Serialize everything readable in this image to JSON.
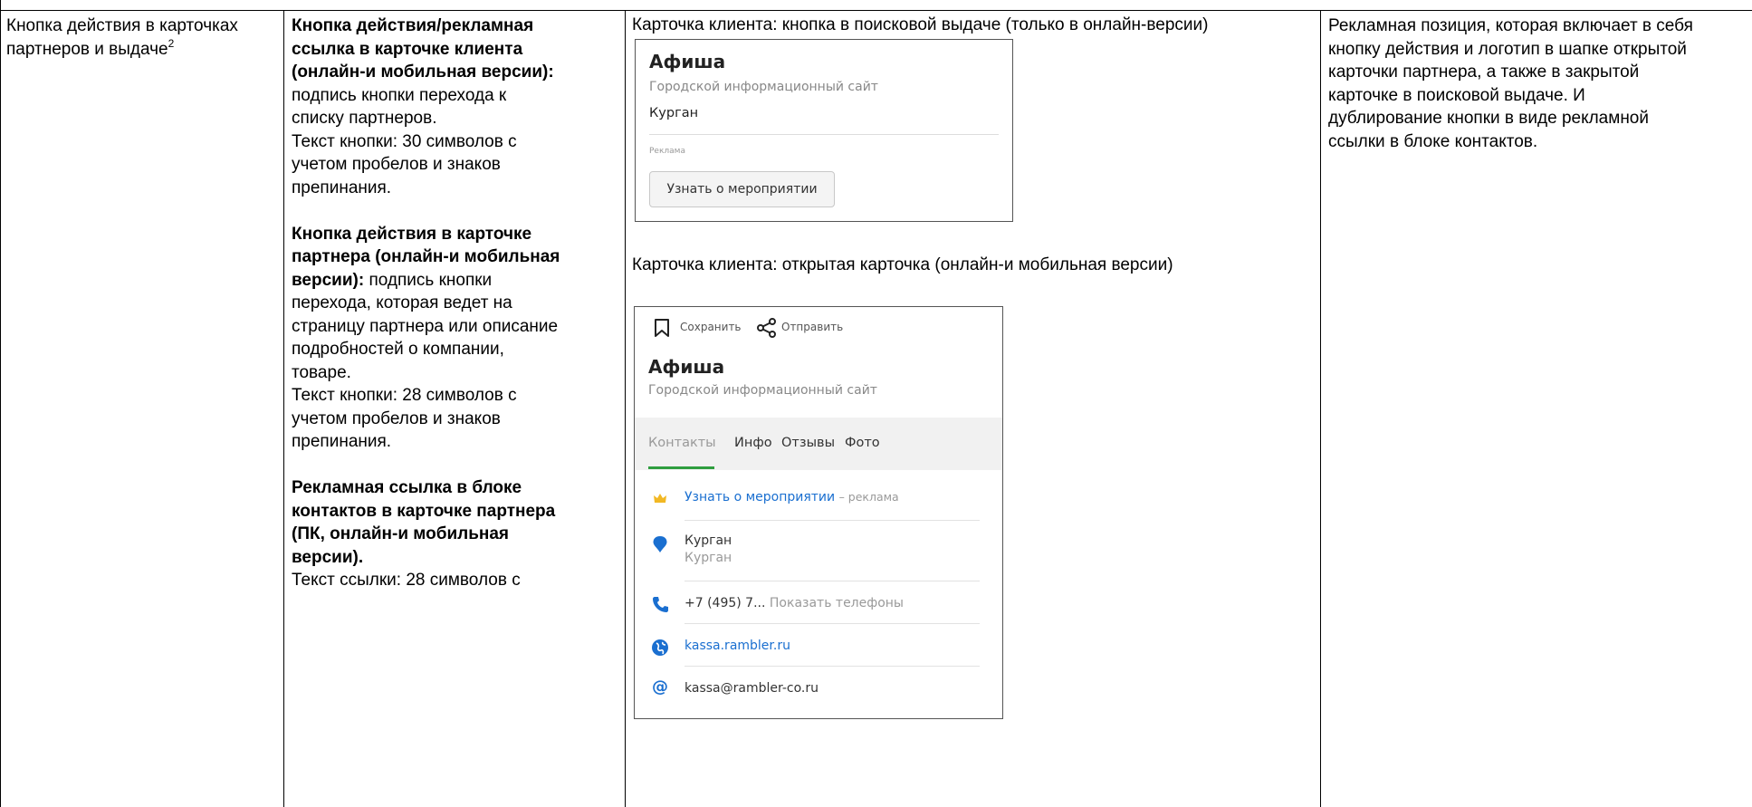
{
  "col1": {
    "text": "Кнопка действия в карточках партнеров и выдаче",
    "footnote": "2"
  },
  "col2": {
    "block1_bold": "Кнопка действия/рекламная ссылка в карточке клиента (онлайн-и мобильная версии):",
    "block1_text": "подпись кнопки перехода к списку партнеров.",
    "block1_limit": "Текст кнопки: 30 символов с учетом пробелов и знаков препинания.",
    "block2_bold": "Кнопка действия в карточке партнера (онлайн-и мобильная версии):",
    "block2_text": "подпись кнопки перехода, которая ведет на страницу партнера или описание подробностей о компании, товаре.",
    "block2_limit": "Текст кнопки: 28 символов с учетом пробелов и знаков препинания.",
    "block3_bold": "Рекламная ссылка в блоке контактов в карточке партнера (ПК, онлайн-и мобильная версии).",
    "block3_limit": "Текст ссылки: 28 символов с"
  },
  "col3": {
    "caption1": "Карточка клиента: кнопка в поисковой выдаче (только в онлайн-версии)",
    "caption2": "Карточка клиента: открытая карточка (онлайн-и мобильная версии)",
    "shot1": {
      "title": "Афиша",
      "subtitle": "Городской информационный сайт",
      "city": "Курган",
      "ad_label": "Реклама",
      "button": "Узнать о мероприятии"
    },
    "shot2": {
      "save": "Сохранить",
      "send": "Отправить",
      "title": "Афиша",
      "subtitle": "Городской информационный сайт",
      "tabs": [
        "Контакты",
        "Инфо",
        "Отзывы",
        "Фото"
      ],
      "ad_link": "Узнать о мероприятии",
      "ad_suffix": "– реклама",
      "address_main": "Курган",
      "address_sub": "Курган",
      "phone": "+7 (495) 7...",
      "phone_show": "Показать телефоны",
      "website": "kassa.rambler.ru",
      "email": "kassa@rambler-co.ru",
      "accent_color": "#2f9e3f",
      "link_color": "#1a6fd0"
    }
  },
  "col4": {
    "lines": [
      "Рекламная позиция, которая включает в себя",
      "кнопку действия и логотип в шапке открытой",
      "карточки партнера, а также в закрытой",
      "карточке в поисковой выдаче. И",
      "дублирование кнопки в виде рекламной",
      "ссылки в блоке контактов."
    ]
  }
}
